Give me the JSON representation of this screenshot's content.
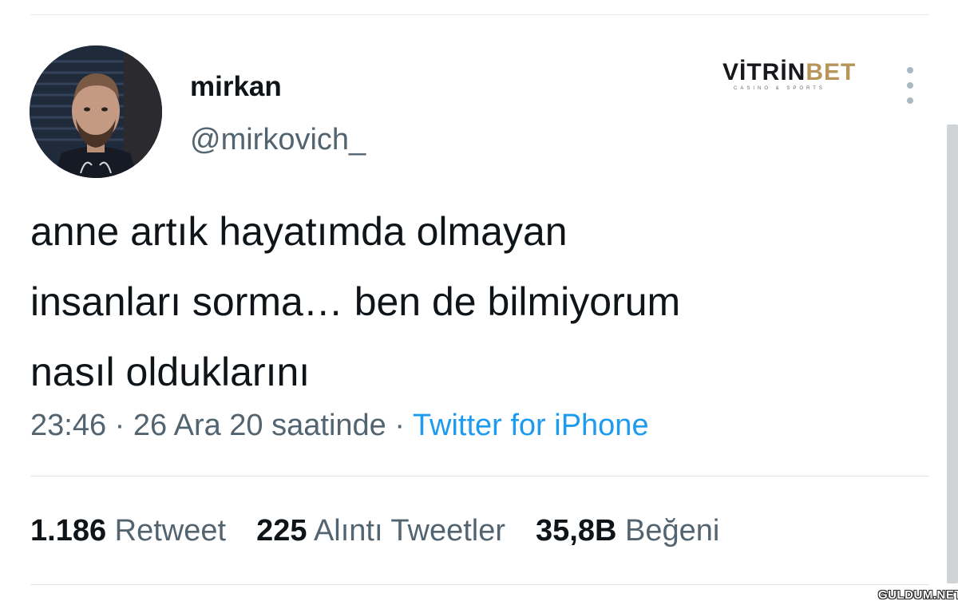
{
  "user": {
    "display_name": "mirkan",
    "handle": "@mirkovich_"
  },
  "watermark_logo": {
    "text_part1": "VİTRİN",
    "text_part2": "BET",
    "tagline": "CASINO & SPORTS"
  },
  "tweet": {
    "lines": [
      "anne artık hayatımda olmayan",
      "insanları sorma… ben de bilmiyorum",
      "nasıl olduklarını"
    ],
    "time": "23:46",
    "separator": " · ",
    "date": "26 Ara 20 saatinde",
    "source": "Twitter for iPhone"
  },
  "stats": [
    {
      "count": "1.186",
      "label": "Retweet"
    },
    {
      "count": "225",
      "label": "Alıntı Tweetler"
    },
    {
      "count": "35,8B",
      "label": "Beğeni"
    }
  ],
  "site_watermark": "GULDUM.NET",
  "colors": {
    "text_primary": "#0f1419",
    "text_secondary": "#536471",
    "link_blue": "#1d9bf0",
    "logo_gold": "#b89559"
  },
  "icons": {
    "more": "more-vertical-icon"
  }
}
